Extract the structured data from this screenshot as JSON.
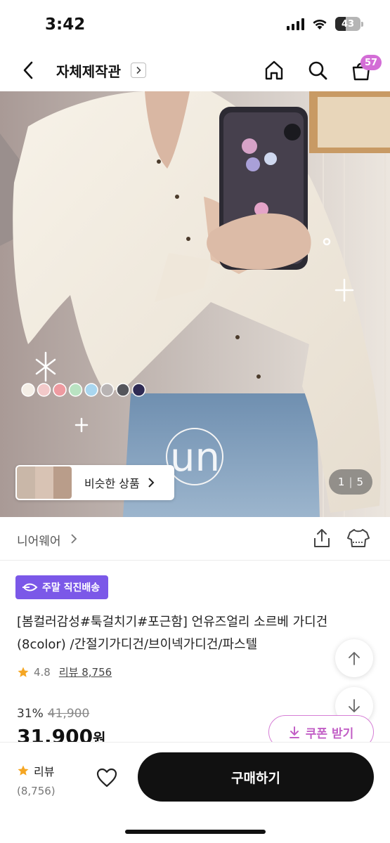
{
  "status": {
    "time": "3:42",
    "battery": "43",
    "battery_level": 0.43
  },
  "header": {
    "title": "자체제작관",
    "cart_count": "57"
  },
  "image": {
    "counter_current": "1",
    "counter_separator": "|",
    "counter_total": "5",
    "similar_label": "비슷한 상품",
    "watermark": "un",
    "swatch_colors": [
      "#f4eee6",
      "#f2c9c9",
      "#ee9aa0",
      "#b9e3c2",
      "#a9d6ef",
      "#b8b3b3",
      "#55565c",
      "#2f2b54"
    ]
  },
  "brand": {
    "name": "니어웨어"
  },
  "delivery": {
    "label": "주말 직진배송",
    "color": "#7b58e8"
  },
  "product": {
    "title_line1": "[봄컬러감성#툭걸치기#포근함] 언유즈얼리 소르베 가디건",
    "title_line2": "(8color) /간절기가디건/브이넥가디건/파스텔",
    "rating": "4.8",
    "review_label": "리뷰 8,756",
    "discount_rate": "31%",
    "original_price": "41,900",
    "price": "31,900",
    "price_unit": "원",
    "coupon_label": "쿠폰 받기"
  },
  "bottom": {
    "review_label": "리뷰",
    "review_count": "(8,756)",
    "buy_label": "구매하기"
  },
  "colors": {
    "accent_pink": "#d36dd6",
    "star": "#f5a623",
    "buy_bg": "#111111"
  }
}
